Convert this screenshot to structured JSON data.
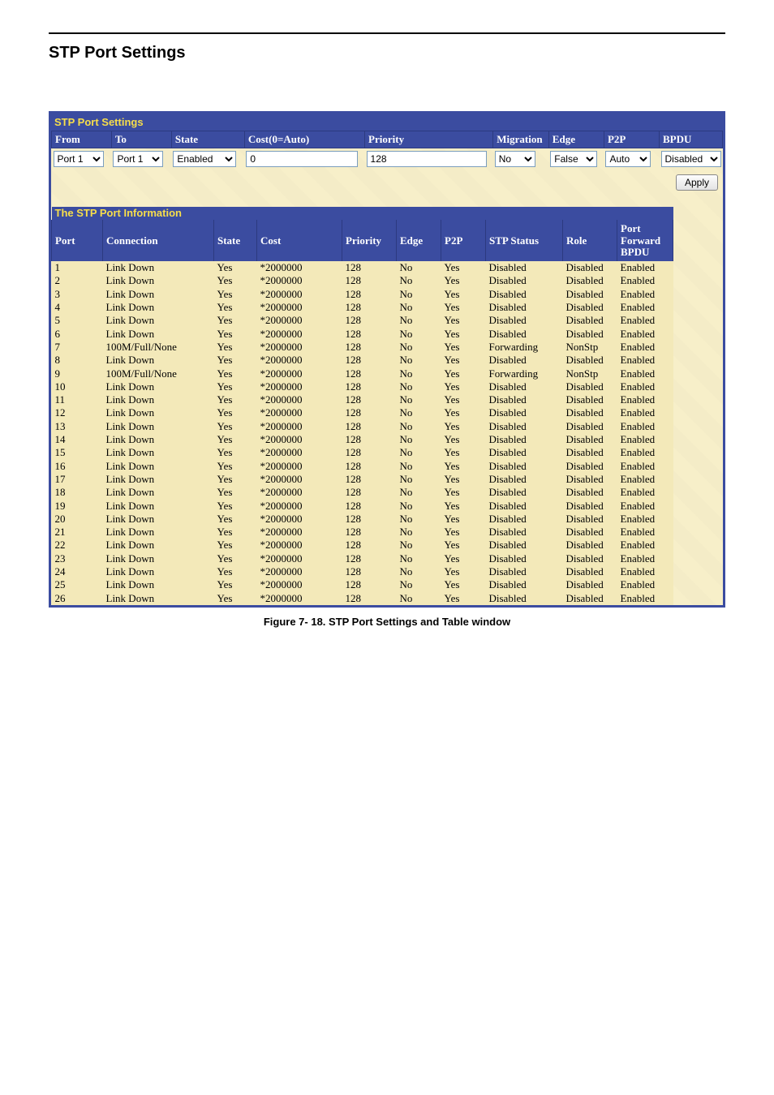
{
  "pageTitle": "STP Port Settings",
  "figureCaption": "Figure 7- 18.  STP Port Settings and Table window",
  "panel1Title": "STP Port Settings",
  "panel2Title": "The STP Port Information",
  "formHeaders": {
    "from": "From",
    "to": "To",
    "state": "State",
    "cost": "Cost(0=Auto)",
    "priority": "Priority",
    "migration": "Migration",
    "edge": "Edge",
    "p2p": "P2P",
    "bpdu": "BPDU"
  },
  "formValues": {
    "from": "Port 1",
    "to": "Port 1",
    "state": "Enabled",
    "cost": "0",
    "priority": "128",
    "migration": "No",
    "edge": "False",
    "p2p": "Auto",
    "bpdu": "Disabled"
  },
  "applyLabel": "Apply",
  "infoHeaders": {
    "port": "Port",
    "connection": "Connection",
    "state": "State",
    "cost": "Cost",
    "priority": "Priority",
    "edge": "Edge",
    "p2p": "P2P",
    "stpstatus": "STP Status",
    "role": "Role",
    "pfb": "Port Forward BPDU"
  },
  "rows": [
    {
      "port": "1",
      "conn": "Link Down",
      "state": "Yes",
      "cost": "*2000000",
      "prio": "128",
      "edge": "No",
      "p2p": "Yes",
      "stp": "Disabled",
      "role": "Disabled",
      "pfb": "Enabled"
    },
    {
      "port": "2",
      "conn": "Link Down",
      "state": "Yes",
      "cost": "*2000000",
      "prio": "128",
      "edge": "No",
      "p2p": "Yes",
      "stp": "Disabled",
      "role": "Disabled",
      "pfb": "Enabled"
    },
    {
      "port": "3",
      "conn": "Link Down",
      "state": "Yes",
      "cost": "*2000000",
      "prio": "128",
      "edge": "No",
      "p2p": "Yes",
      "stp": "Disabled",
      "role": "Disabled",
      "pfb": "Enabled"
    },
    {
      "port": "4",
      "conn": "Link Down",
      "state": "Yes",
      "cost": "*2000000",
      "prio": "128",
      "edge": "No",
      "p2p": "Yes",
      "stp": "Disabled",
      "role": "Disabled",
      "pfb": "Enabled"
    },
    {
      "port": "5",
      "conn": "Link Down",
      "state": "Yes",
      "cost": "*2000000",
      "prio": "128",
      "edge": "No",
      "p2p": "Yes",
      "stp": "Disabled",
      "role": "Disabled",
      "pfb": "Enabled"
    },
    {
      "port": "6",
      "conn": "Link Down",
      "state": "Yes",
      "cost": "*2000000",
      "prio": "128",
      "edge": "No",
      "p2p": "Yes",
      "stp": "Disabled",
      "role": "Disabled",
      "pfb": "Enabled"
    },
    {
      "port": "7",
      "conn": "100M/Full/None",
      "state": "Yes",
      "cost": "*2000000",
      "prio": "128",
      "edge": "No",
      "p2p": "Yes",
      "stp": "Forwarding",
      "role": "NonStp",
      "pfb": "Enabled"
    },
    {
      "port": "8",
      "conn": "Link Down",
      "state": "Yes",
      "cost": "*2000000",
      "prio": "128",
      "edge": "No",
      "p2p": "Yes",
      "stp": "Disabled",
      "role": "Disabled",
      "pfb": "Enabled"
    },
    {
      "port": "9",
      "conn": "100M/Full/None",
      "state": "Yes",
      "cost": "*2000000",
      "prio": "128",
      "edge": "No",
      "p2p": "Yes",
      "stp": "Forwarding",
      "role": "NonStp",
      "pfb": "Enabled"
    },
    {
      "port": "10",
      "conn": "Link Down",
      "state": "Yes",
      "cost": "*2000000",
      "prio": "128",
      "edge": "No",
      "p2p": "Yes",
      "stp": "Disabled",
      "role": "Disabled",
      "pfb": "Enabled"
    },
    {
      "port": "11",
      "conn": "Link Down",
      "state": "Yes",
      "cost": "*2000000",
      "prio": "128",
      "edge": "No",
      "p2p": "Yes",
      "stp": "Disabled",
      "role": "Disabled",
      "pfb": "Enabled"
    },
    {
      "port": "12",
      "conn": "Link Down",
      "state": "Yes",
      "cost": "*2000000",
      "prio": "128",
      "edge": "No",
      "p2p": "Yes",
      "stp": "Disabled",
      "role": "Disabled",
      "pfb": "Enabled"
    },
    {
      "port": "13",
      "conn": "Link Down",
      "state": "Yes",
      "cost": "*2000000",
      "prio": "128",
      "edge": "No",
      "p2p": "Yes",
      "stp": "Disabled",
      "role": "Disabled",
      "pfb": "Enabled"
    },
    {
      "port": "14",
      "conn": "Link Down",
      "state": "Yes",
      "cost": "*2000000",
      "prio": "128",
      "edge": "No",
      "p2p": "Yes",
      "stp": "Disabled",
      "role": "Disabled",
      "pfb": "Enabled"
    },
    {
      "port": "15",
      "conn": "Link Down",
      "state": "Yes",
      "cost": "*2000000",
      "prio": "128",
      "edge": "No",
      "p2p": "Yes",
      "stp": "Disabled",
      "role": "Disabled",
      "pfb": "Enabled"
    },
    {
      "port": "16",
      "conn": "Link Down",
      "state": "Yes",
      "cost": "*2000000",
      "prio": "128",
      "edge": "No",
      "p2p": "Yes",
      "stp": "Disabled",
      "role": "Disabled",
      "pfb": "Enabled"
    },
    {
      "port": "17",
      "conn": "Link Down",
      "state": "Yes",
      "cost": "*2000000",
      "prio": "128",
      "edge": "No",
      "p2p": "Yes",
      "stp": "Disabled",
      "role": "Disabled",
      "pfb": "Enabled"
    },
    {
      "port": "18",
      "conn": "Link Down",
      "state": "Yes",
      "cost": "*2000000",
      "prio": "128",
      "edge": "No",
      "p2p": "Yes",
      "stp": "Disabled",
      "role": "Disabled",
      "pfb": "Enabled"
    },
    {
      "port": "19",
      "conn": "Link Down",
      "state": "Yes",
      "cost": "*2000000",
      "prio": "128",
      "edge": "No",
      "p2p": "Yes",
      "stp": "Disabled",
      "role": "Disabled",
      "pfb": "Enabled"
    },
    {
      "port": "20",
      "conn": "Link Down",
      "state": "Yes",
      "cost": "*2000000",
      "prio": "128",
      "edge": "No",
      "p2p": "Yes",
      "stp": "Disabled",
      "role": "Disabled",
      "pfb": "Enabled"
    },
    {
      "port": "21",
      "conn": "Link Down",
      "state": "Yes",
      "cost": "*2000000",
      "prio": "128",
      "edge": "No",
      "p2p": "Yes",
      "stp": "Disabled",
      "role": "Disabled",
      "pfb": "Enabled"
    },
    {
      "port": "22",
      "conn": "Link Down",
      "state": "Yes",
      "cost": "*2000000",
      "prio": "128",
      "edge": "No",
      "p2p": "Yes",
      "stp": "Disabled",
      "role": "Disabled",
      "pfb": "Enabled"
    },
    {
      "port": "23",
      "conn": "Link Down",
      "state": "Yes",
      "cost": "*2000000",
      "prio": "128",
      "edge": "No",
      "p2p": "Yes",
      "stp": "Disabled",
      "role": "Disabled",
      "pfb": "Enabled"
    },
    {
      "port": "24",
      "conn": "Link Down",
      "state": "Yes",
      "cost": "*2000000",
      "prio": "128",
      "edge": "No",
      "p2p": "Yes",
      "stp": "Disabled",
      "role": "Disabled",
      "pfb": "Enabled"
    },
    {
      "port": "25",
      "conn": "Link Down",
      "state": "Yes",
      "cost": "*2000000",
      "prio": "128",
      "edge": "No",
      "p2p": "Yes",
      "stp": "Disabled",
      "role": "Disabled",
      "pfb": "Enabled"
    },
    {
      "port": "26",
      "conn": "Link Down",
      "state": "Yes",
      "cost": "*2000000",
      "prio": "128",
      "edge": "No",
      "p2p": "Yes",
      "stp": "Disabled",
      "role": "Disabled",
      "pfb": "Enabled"
    }
  ]
}
